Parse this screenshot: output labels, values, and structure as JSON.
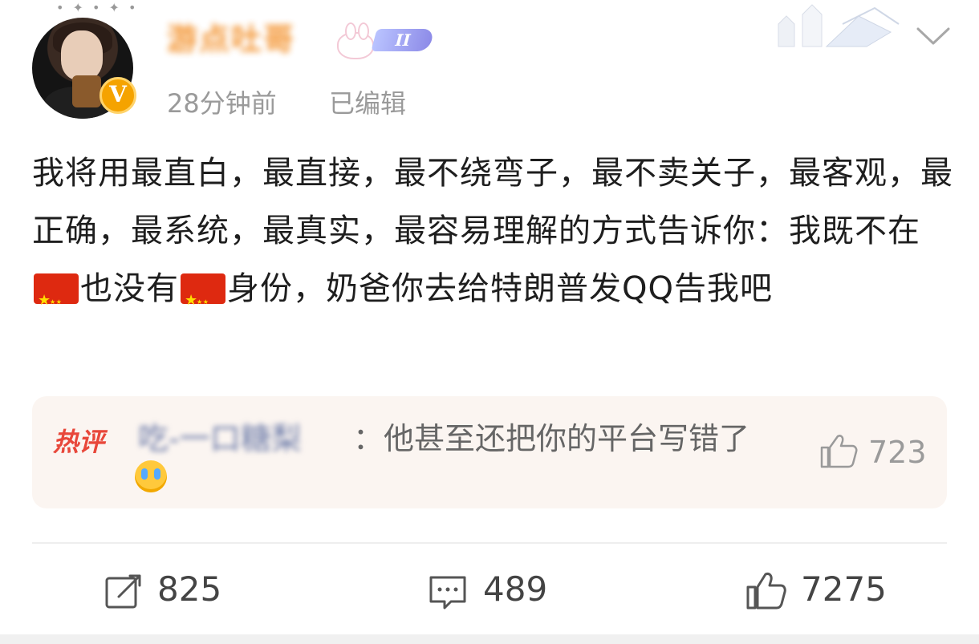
{
  "header": {
    "username": "游点吐哥",
    "level_badge": "II",
    "post_time": "28分钟前",
    "edited_label": "已编辑",
    "verified_badge": "V"
  },
  "post": {
    "text_before_flag1": "我将用最直白，最直接，最不绕弯子，最不卖关子，最客观，最正确，最系统，最真实，最容易理解的方式告诉你：我既不在",
    "text_between_flags": "也没有",
    "text_after_flag2": "身份，奶爸你去给特朗普发QQ告我吧"
  },
  "hot_comment": {
    "tag": "热评",
    "commenter": "吃-一口糖梨",
    "text": "：他甚至还把你的平台写错了",
    "likes": "723"
  },
  "actions": {
    "repost_count": "825",
    "comment_count": "489",
    "like_count": "7275"
  },
  "colors": {
    "username": "#f28a1e",
    "hot_tag": "#e8473a",
    "commenter": "#6b7aa8",
    "flag": "#de2910"
  }
}
